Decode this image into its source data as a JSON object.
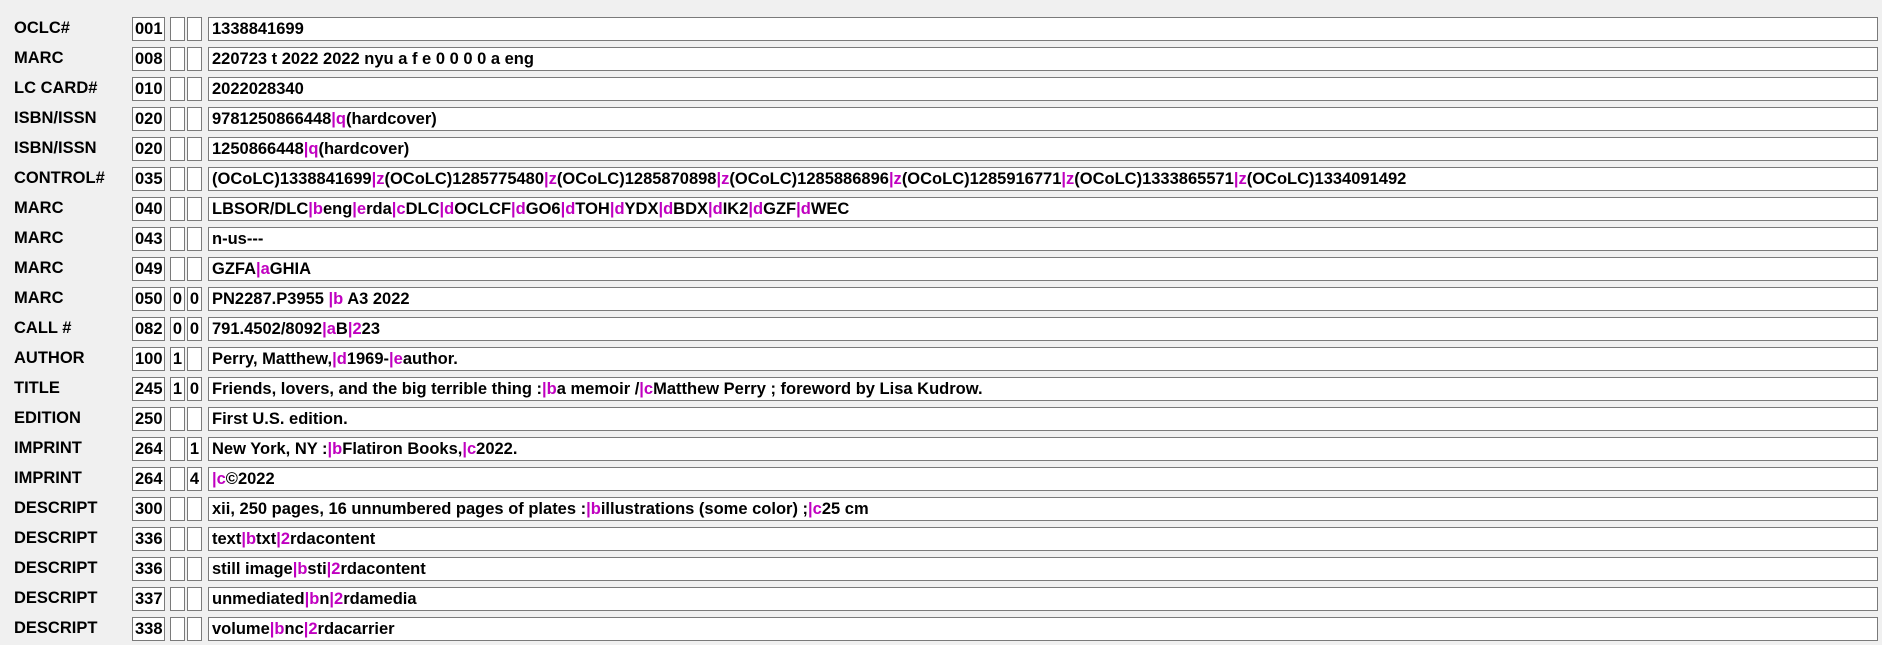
{
  "record": {
    "fields": [
      {
        "label": "OCLC#",
        "tag": "001",
        "ind1": "",
        "ind2": "",
        "segments": [
          {
            "t": "1338841699"
          }
        ]
      },
      {
        "label": "MARC",
        "tag": "008",
        "ind1": "",
        "ind2": "",
        "segments": [
          {
            "t": "220723 t 2022 2022 nyu a f     e              0 0 0   0 a eng"
          }
        ]
      },
      {
        "label": "LC CARD#",
        "tag": "010",
        "ind1": "",
        "ind2": "",
        "segments": [
          {
            "t": "2022028340"
          }
        ]
      },
      {
        "label": "ISBN/ISSN",
        "tag": "020",
        "ind1": "",
        "ind2": "",
        "segments": [
          {
            "t": "9781250866448"
          },
          {
            "t": "|q",
            "sf": true
          },
          {
            "t": "(hardcover)"
          }
        ]
      },
      {
        "label": "ISBN/ISSN",
        "tag": "020",
        "ind1": "",
        "ind2": "",
        "segments": [
          {
            "t": "1250866448"
          },
          {
            "t": "|q",
            "sf": true
          },
          {
            "t": "(hardcover)"
          }
        ]
      },
      {
        "label": "CONTROL#",
        "tag": "035",
        "ind1": "",
        "ind2": "",
        "segments": [
          {
            "t": "(OCoLC)1338841699"
          },
          {
            "t": "|z",
            "sf": true
          },
          {
            "t": "(OCoLC)1285775480"
          },
          {
            "t": "|z",
            "sf": true
          },
          {
            "t": "(OCoLC)1285870898"
          },
          {
            "t": "|z",
            "sf": true
          },
          {
            "t": "(OCoLC)1285886896"
          },
          {
            "t": "|z",
            "sf": true
          },
          {
            "t": "(OCoLC)1285916771"
          },
          {
            "t": "|z",
            "sf": true
          },
          {
            "t": "(OCoLC)1333865571"
          },
          {
            "t": "|z",
            "sf": true
          },
          {
            "t": "(OCoLC)1334091492"
          }
        ]
      },
      {
        "label": "MARC",
        "tag": "040",
        "ind1": "",
        "ind2": "",
        "segments": [
          {
            "t": "LBSOR/DLC"
          },
          {
            "t": "|b",
            "sf": true
          },
          {
            "t": "eng"
          },
          {
            "t": "|e",
            "sf": true
          },
          {
            "t": "rda"
          },
          {
            "t": "|c",
            "sf": true
          },
          {
            "t": "DLC"
          },
          {
            "t": "|d",
            "sf": true
          },
          {
            "t": "OCLCF"
          },
          {
            "t": "|d",
            "sf": true
          },
          {
            "t": "GO6"
          },
          {
            "t": "|d",
            "sf": true
          },
          {
            "t": "TOH"
          },
          {
            "t": "|d",
            "sf": true
          },
          {
            "t": "YDX"
          },
          {
            "t": "|d",
            "sf": true
          },
          {
            "t": "BDX"
          },
          {
            "t": "|d",
            "sf": true
          },
          {
            "t": "IK2"
          },
          {
            "t": "|d",
            "sf": true
          },
          {
            "t": "GZF"
          },
          {
            "t": "|d",
            "sf": true
          },
          {
            "t": "WEC"
          }
        ]
      },
      {
        "label": "MARC",
        "tag": "043",
        "ind1": "",
        "ind2": "",
        "segments": [
          {
            "t": "n-us---"
          }
        ]
      },
      {
        "label": "MARC",
        "tag": "049",
        "ind1": "",
        "ind2": "",
        "segments": [
          {
            "t": "GZFA"
          },
          {
            "t": "|a",
            "sf": true
          },
          {
            "t": "GHIA"
          }
        ]
      },
      {
        "label": "MARC",
        "tag": "050",
        "ind1": "0",
        "ind2": "0",
        "segments": [
          {
            "t": "PN2287.P3955 "
          },
          {
            "t": "|b",
            "sf": true
          },
          {
            "t": " A3 2022"
          }
        ]
      },
      {
        "label": "CALL #",
        "tag": "082",
        "ind1": "0",
        "ind2": "0",
        "segments": [
          {
            "t": "791.4502/8092"
          },
          {
            "t": "|a",
            "sf": true
          },
          {
            "t": "B"
          },
          {
            "t": "|2",
            "sf": true
          },
          {
            "t": "23"
          }
        ]
      },
      {
        "label": "AUTHOR",
        "tag": "100",
        "ind1": "1",
        "ind2": "",
        "segments": [
          {
            "t": "Perry, Matthew,"
          },
          {
            "t": "|d",
            "sf": true
          },
          {
            "t": "1969-"
          },
          {
            "t": "|e",
            "sf": true
          },
          {
            "t": "author."
          }
        ]
      },
      {
        "label": "TITLE",
        "tag": "245",
        "ind1": "1",
        "ind2": "0",
        "segments": [
          {
            "t": "Friends, lovers, and the big terrible thing :"
          },
          {
            "t": "|b",
            "sf": true
          },
          {
            "t": "a memoir /"
          },
          {
            "t": "|c",
            "sf": true
          },
          {
            "t": "Matthew Perry ; foreword by Lisa Kudrow."
          }
        ]
      },
      {
        "label": "EDITION",
        "tag": "250",
        "ind1": "",
        "ind2": "",
        "segments": [
          {
            "t": "First U.S. edition."
          }
        ]
      },
      {
        "label": "IMPRINT",
        "tag": "264",
        "ind1": "",
        "ind2": "1",
        "segments": [
          {
            "t": "New York, NY :"
          },
          {
            "t": "|b",
            "sf": true
          },
          {
            "t": "Flatiron Books,"
          },
          {
            "t": "|c",
            "sf": true
          },
          {
            "t": "2022."
          }
        ]
      },
      {
        "label": "IMPRINT",
        "tag": "264",
        "ind1": "",
        "ind2": "4",
        "segments": [
          {
            "t": "|c",
            "sf": true
          },
          {
            "t": "©2022"
          }
        ]
      },
      {
        "label": "DESCRIPT",
        "tag": "300",
        "ind1": "",
        "ind2": "",
        "segments": [
          {
            "t": "xii, 250 pages, 16 unnumbered pages of plates :"
          },
          {
            "t": "|b",
            "sf": true
          },
          {
            "t": "illustrations (some color) ;"
          },
          {
            "t": "|c",
            "sf": true
          },
          {
            "t": "25 cm"
          }
        ]
      },
      {
        "label": "DESCRIPT",
        "tag": "336",
        "ind1": "",
        "ind2": "",
        "segments": [
          {
            "t": "text"
          },
          {
            "t": "|b",
            "sf": true
          },
          {
            "t": "txt"
          },
          {
            "t": "|2",
            "sf": true
          },
          {
            "t": "rdacontent"
          }
        ]
      },
      {
        "label": "DESCRIPT",
        "tag": "336",
        "ind1": "",
        "ind2": "",
        "segments": [
          {
            "t": "still image"
          },
          {
            "t": "|b",
            "sf": true
          },
          {
            "t": "sti"
          },
          {
            "t": "|2",
            "sf": true
          },
          {
            "t": "rdacontent"
          }
        ]
      },
      {
        "label": "DESCRIPT",
        "tag": "337",
        "ind1": "",
        "ind2": "",
        "segments": [
          {
            "t": "unmediated"
          },
          {
            "t": "|b",
            "sf": true
          },
          {
            "t": "n"
          },
          {
            "t": "|2",
            "sf": true
          },
          {
            "t": "rdamedia"
          }
        ]
      },
      {
        "label": "DESCRIPT",
        "tag": "338",
        "ind1": "",
        "ind2": "",
        "segments": [
          {
            "t": "volume"
          },
          {
            "t": "|b",
            "sf": true
          },
          {
            "t": "nc"
          },
          {
            "t": "|2",
            "sf": true
          },
          {
            "t": "rdacarrier"
          }
        ]
      }
    ]
  },
  "colors": {
    "background": "#f0f0f0",
    "field_box": "#ffffff",
    "subfield_delimiter": "#c000c0"
  }
}
